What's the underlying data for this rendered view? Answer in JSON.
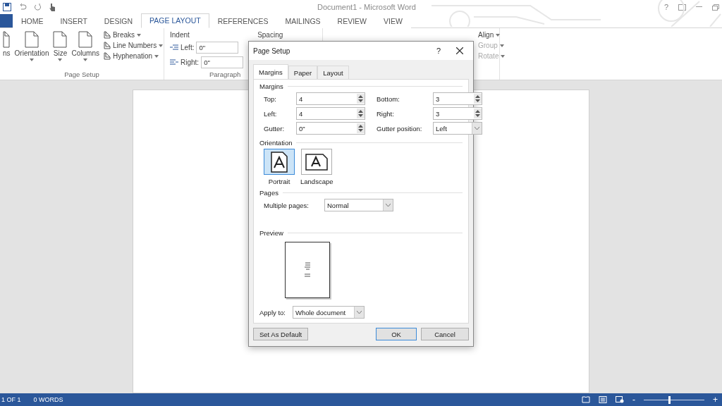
{
  "window": {
    "title": "Document1 - Microsoft Word",
    "help": "?"
  },
  "ribbon_tabs": [
    {
      "selected": false,
      "kind": "file"
    },
    {
      "label": "HOME",
      "selected": false,
      "kind": "tab"
    },
    {
      "label": "INSERT",
      "selected": false,
      "kind": "tab"
    },
    {
      "label": "DESIGN",
      "selected": false,
      "kind": "tab"
    },
    {
      "label": "PAGE LAYOUT",
      "selected": true,
      "kind": "tab"
    },
    {
      "label": "REFERENCES",
      "selected": false,
      "kind": "tab"
    },
    {
      "label": "MAILINGS",
      "selected": false,
      "kind": "tab"
    },
    {
      "label": "REVIEW",
      "selected": false,
      "kind": "tab"
    },
    {
      "label": "VIEW",
      "selected": false,
      "kind": "tab"
    }
  ],
  "page_setup_group": {
    "label": "Page Setup",
    "big_buttons": [
      "ns",
      "Orientation",
      "Size",
      "Columns"
    ],
    "small_buttons": [
      "Breaks",
      "Line Numbers",
      "Hyphenation"
    ]
  },
  "paragraph_group": {
    "label": "Paragraph",
    "indent_heading": "Indent",
    "spacing_heading": "Spacing",
    "indent_left_label": "Left:",
    "indent_left": "0\"",
    "indent_right_label": "Right:",
    "indent_right": "0\""
  },
  "arrange_group": [
    {
      "label": "Align",
      "disabled": false
    },
    {
      "label": "Group",
      "disabled": true
    },
    {
      "label": "Rotate",
      "disabled": true
    }
  ],
  "dialog": {
    "title": "Page Setup",
    "help": "?",
    "tabs": [
      {
        "label": "Margins",
        "selected": true
      },
      {
        "label": "Paper",
        "selected": false
      },
      {
        "label": "Layout",
        "selected": false
      }
    ],
    "margins_heading": "Margins",
    "margin_fields": [
      {
        "label": "Top:",
        "value": "4",
        "kind": "spin"
      },
      {
        "label": "Bottom:",
        "value": "3",
        "kind": "spin"
      },
      {
        "label": "Left:",
        "value": "4",
        "kind": "spin"
      },
      {
        "label": "Right:",
        "value": "3",
        "kind": "spin"
      },
      {
        "label": "Gutter:",
        "value": "0\"",
        "kind": "spin"
      },
      {
        "label": "Gutter position:",
        "value": "Left",
        "kind": "dropdown"
      }
    ],
    "orientation_heading": "Orientation",
    "orientations": [
      {
        "label": "Portrait",
        "selected": true
      },
      {
        "label": "Landscape",
        "selected": false
      }
    ],
    "pages_heading": "Pages",
    "multiple_pages_label": "Multiple pages:",
    "multiple_pages": "Normal",
    "preview_heading": "Preview",
    "apply_to_label": "Apply to:",
    "apply_to": "Whole document",
    "buttons": [
      {
        "label": "Set As Default",
        "default": false
      },
      {
        "label": "OK",
        "default": true
      },
      {
        "label": "Cancel",
        "default": false
      }
    ]
  },
  "status_bar": {
    "page": "1 OF 1",
    "words": "0 WORDS",
    "zoom": {
      "out": "-",
      "level": 0.42,
      "in": "+"
    }
  }
}
